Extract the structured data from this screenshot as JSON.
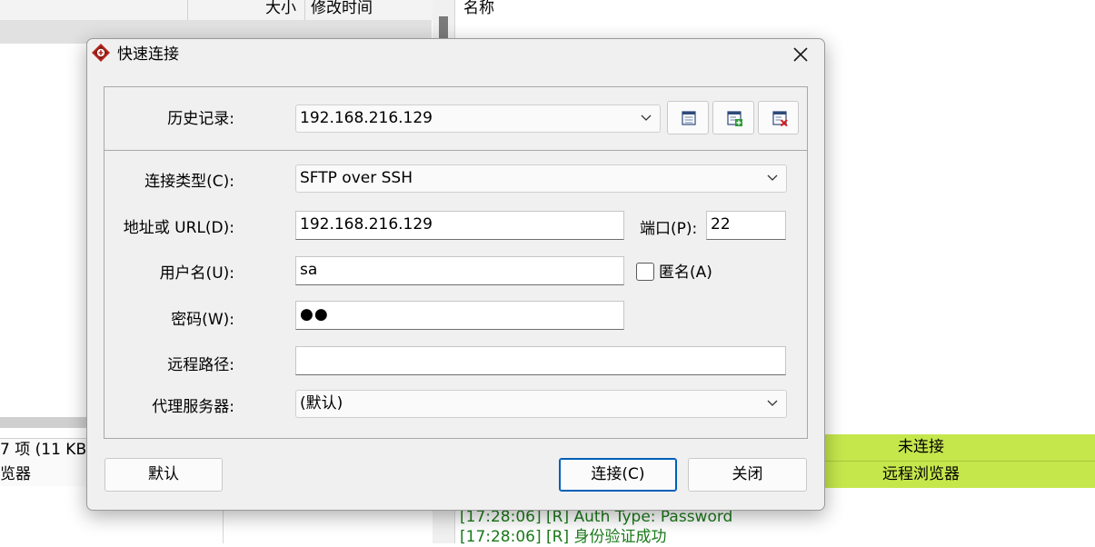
{
  "background": {
    "col_size": "大小",
    "col_mtime": "修改时间",
    "col_name": "名称",
    "left_status": "7 项 (11 KB /",
    "left_browser": "览器",
    "right_status": "未连接",
    "right_browser": "远程浏览器",
    "log": [
      "[17:28:06]  [R] Auth Type: Password",
      "[17:28:06]  [R] 身份验证成功"
    ]
  },
  "dialog": {
    "title": "快速连接",
    "history_label": "历史记录:",
    "history_value": "192.168.216.129",
    "conn_type_label": "连接类型(C):",
    "conn_type_value": "SFTP over SSH",
    "address_label": "地址或 URL(D):",
    "address_value": "192.168.216.129",
    "port_label": "端口(P):",
    "port_value": "22",
    "username_label": "用户名(U):",
    "username_value": "sa",
    "anonymous_label": "匿名(A)",
    "password_label": "密码(W):",
    "password_mask": "●●",
    "remote_path_label": "远程路径:",
    "remote_path_value": "",
    "proxy_label": "代理服务器:",
    "proxy_value": "(默认)",
    "default_button": "默认",
    "connect_button": "连接(C)",
    "close_button": "关闭"
  },
  "colors": {
    "status_green": "#c6e74c",
    "log_green": "#1a7a1a",
    "accent_blue": "#005fb8"
  }
}
